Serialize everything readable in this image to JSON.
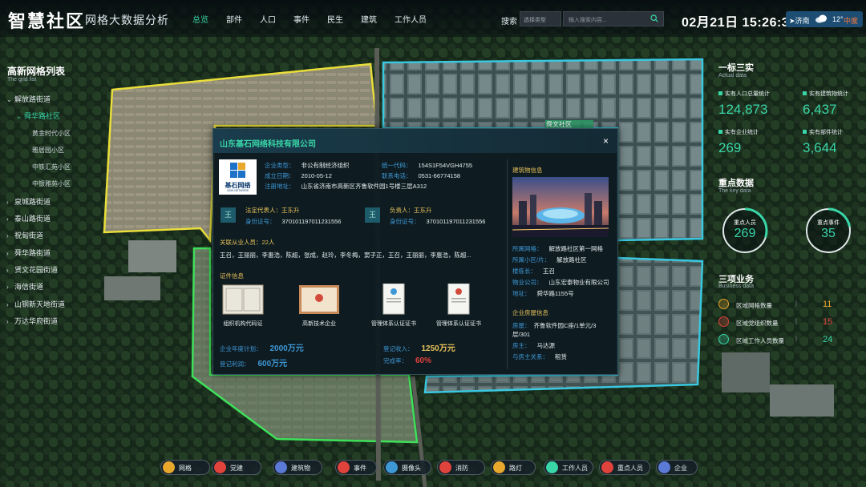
{
  "header": {
    "logo": "智慧社区",
    "subtitle": "网格大数据分析",
    "nav": [
      "总览",
      "部件",
      "人口",
      "事件",
      "民生",
      "建筑",
      "工作人员"
    ],
    "search_label": "搜索",
    "search_select": "选择类型",
    "search_placeholder": "输入搜索内容...",
    "datetime": "02月21日 15:26:30",
    "weather": {
      "city": "济南",
      "temp": "12°",
      "level": "中度"
    }
  },
  "map_label": "舜文社区",
  "grid_list": {
    "title": "高新网格列表",
    "subtitle": "The grid list",
    "items": [
      {
        "label": "解放路街道",
        "level": 1,
        "open": true
      },
      {
        "label": "舜华路社区",
        "level": 2,
        "open": true
      },
      {
        "label": "黄金时代小区",
        "level": 3
      },
      {
        "label": "雅居园小区",
        "level": 3
      },
      {
        "label": "中铁汇苑小区",
        "level": 3
      },
      {
        "label": "中银雅苑小区",
        "level": 3
      },
      {
        "label": "泉城路街道",
        "level": 1
      },
      {
        "label": "泰山路街道",
        "level": 1
      },
      {
        "label": "祝甸街道",
        "level": 1
      },
      {
        "label": "舜华路街道",
        "level": 1
      },
      {
        "label": "贤文花园街道",
        "level": 1
      },
      {
        "label": "海信街道",
        "level": 1
      },
      {
        "label": "山钢新天地街道",
        "level": 1
      },
      {
        "label": "万达华府街道",
        "level": 1
      }
    ]
  },
  "actual_data": {
    "title": "一标三实",
    "subtitle": "Actual data",
    "stats": [
      {
        "label": "实有人口总量统计",
        "value": "124,873"
      },
      {
        "label": "实有建筑物统计",
        "value": "6,437"
      },
      {
        "label": "实有企业统计",
        "value": "269"
      },
      {
        "label": "实有部件统计",
        "value": "3,644"
      }
    ]
  },
  "key_data": {
    "title": "重点数据",
    "subtitle": "The key data",
    "rings": [
      {
        "label": "重点人员",
        "value": "269",
        "fraction": 0.3
      },
      {
        "label": "重点事件",
        "value": "35",
        "fraction": 0.22
      }
    ]
  },
  "business_data": {
    "title": "三项业务",
    "subtitle": "Business data",
    "rows": [
      {
        "label": "区域网格数量",
        "value": "11",
        "color": "#e8a82c"
      },
      {
        "label": "区域党组织数量",
        "value": "15",
        "color": "#e0433c"
      },
      {
        "label": "区域工作人员数量",
        "value": "24",
        "color": "#39d6a8"
      }
    ]
  },
  "popup": {
    "title": "山东基石网络科技有限公司",
    "close": "×",
    "logo_text": "基石网络",
    "logo_en": "JISHI NETWORK",
    "info": [
      {
        "key": "企业类型：",
        "value": "非公有制经济组织"
      },
      {
        "key": "统一代码：",
        "value": "154S1F54VGH4755"
      },
      {
        "key": "成立日期：",
        "value": "2010-05-12"
      },
      {
        "key": "联系电话：",
        "value": "0531-66774158"
      },
      {
        "key": "注册地址：",
        "value": "山东省济南市高新区齐鲁软件园1号楼三层A312"
      }
    ],
    "legal": {
      "badge": "王",
      "key": "法定代表人：",
      "name": "王东升",
      "id_key": "身份证号：",
      "id": "370101197011231556"
    },
    "manager": {
      "badge": "王",
      "key": "负责人：",
      "name": "王东升",
      "id_key": "身份证号：",
      "id": "370101197011231556"
    },
    "employees": {
      "title": "关联从业人员：",
      "count": "22人",
      "names": "王召，王丽丽，李惠浩，陈超，张成，赵玲，李冬梅，窦子正，王召，王丽丽，李惠浩，陈超..."
    },
    "certs": {
      "title": "证件信息",
      "items": [
        "组织机构代码证",
        "高新技术企业",
        "管理体系认证证书",
        "管理体系认证证书"
      ]
    },
    "finance": [
      {
        "key": "企业年度计划：",
        "value": "2000万元",
        "color": "#3e98d6"
      },
      {
        "key": "登记收入：",
        "value": "1250万元",
        "color": "#e8c25a"
      },
      {
        "key": "登记利润：",
        "value": "600万元",
        "color": "#3e98d6"
      },
      {
        "key": "完成率：",
        "value": "60%",
        "color": "#e0433c"
      }
    ],
    "building": {
      "title": "建筑物信息",
      "info": [
        {
          "key": "所属网格：",
          "value": "解放路社区第一网格"
        },
        {
          "key": "所属小区/片：",
          "value": "解放路社区"
        },
        {
          "key": "楼栋长：",
          "value": "王召"
        },
        {
          "key": "物业公司：",
          "value": "山东宏泰物业有限公司"
        },
        {
          "key": "地址：",
          "value": "舜华路1155号"
        }
      ]
    },
    "lease": {
      "title": "企业房屋信息",
      "info": [
        {
          "key": "房屋：",
          "value": "齐鲁软件园C座/1单元/3层/301"
        },
        {
          "key": "房主：",
          "value": "马达源"
        },
        {
          "key": "与房主关系：",
          "value": "租赁"
        }
      ]
    }
  },
  "bottom_bar": [
    {
      "label": "网格",
      "icon": "grid-icon",
      "color": "#e8a82c"
    },
    {
      "label": "党建",
      "icon": "party-icon",
      "color": "#e0433c"
    },
    {
      "label": "建筑物",
      "icon": "building-icon",
      "color": "#5b7ad6"
    },
    {
      "label": "事件",
      "icon": "event-icon",
      "color": "#e0433c"
    },
    {
      "label": "摄像头",
      "icon": "camera-icon",
      "color": "#3e98d6"
    },
    {
      "label": "消防",
      "icon": "fire-icon",
      "color": "#e0433c"
    },
    {
      "label": "路灯",
      "icon": "streetlight-icon",
      "color": "#e8a82c"
    },
    {
      "label": "工作人员",
      "icon": "worker-icon",
      "color": "#39d6a8"
    },
    {
      "label": "重点人员",
      "icon": "key-person-icon",
      "color": "#e0433c"
    },
    {
      "label": "企业",
      "icon": "enterprise-icon",
      "color": "#5b7ad6"
    }
  ]
}
